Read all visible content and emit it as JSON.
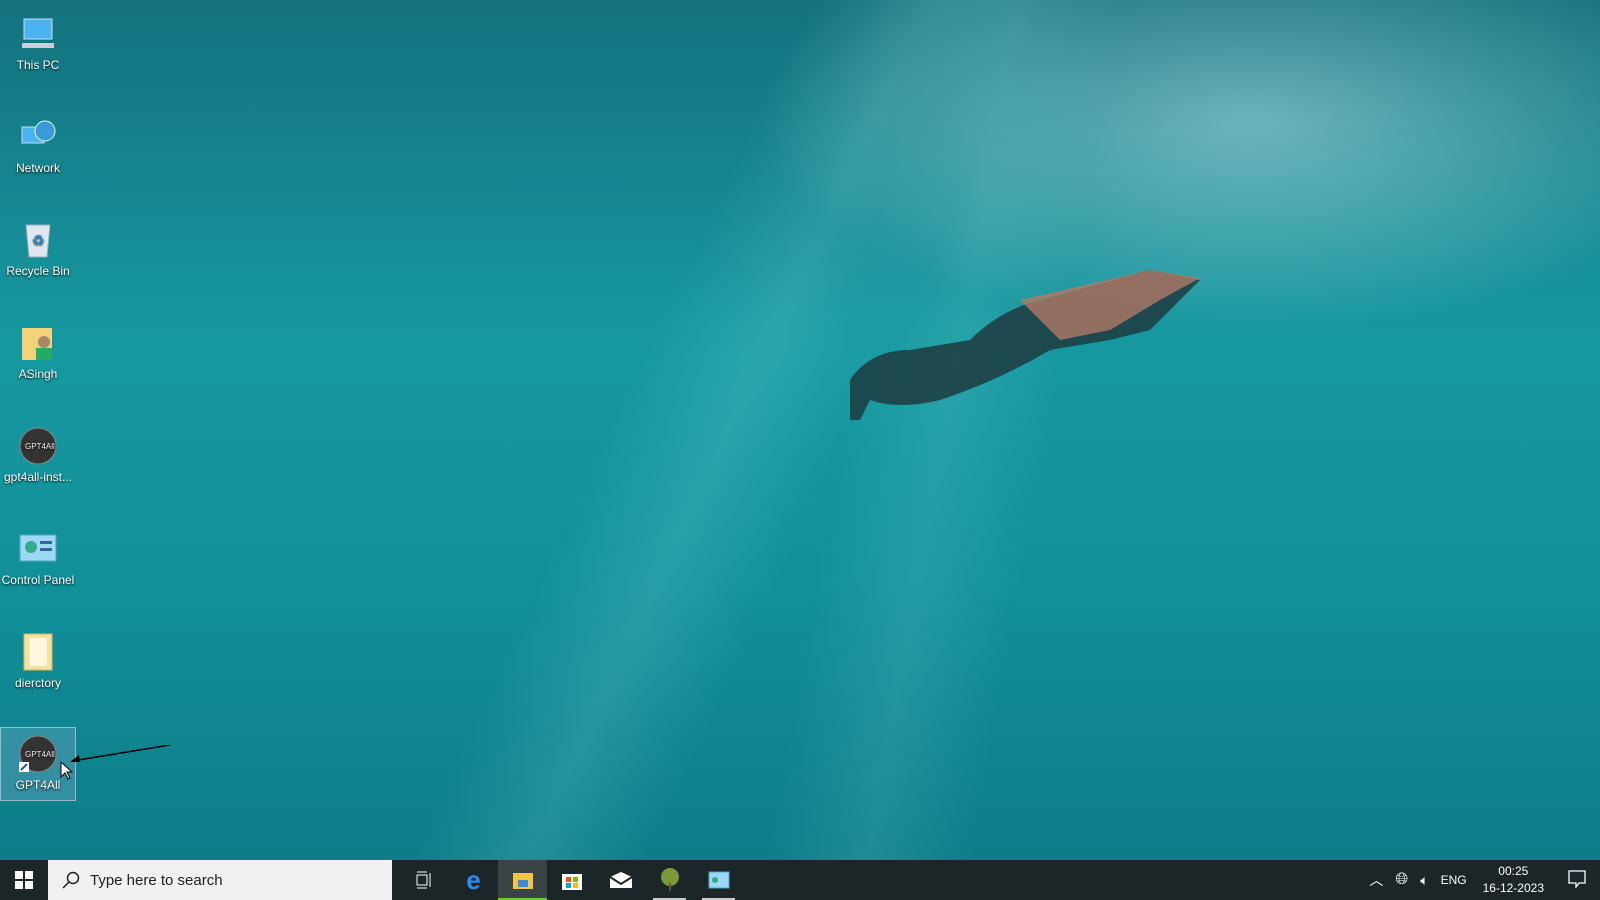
{
  "desktop": {
    "icons": [
      {
        "label": "This PC",
        "icon": "computer-icon"
      },
      {
        "label": "Network",
        "icon": "network-icon"
      },
      {
        "label": "Recycle Bin",
        "icon": "recycle-bin-icon"
      },
      {
        "label": "ASingh",
        "icon": "user-folder-icon"
      },
      {
        "label": "gpt4all-inst...",
        "icon": "gpt4all-installer-icon"
      },
      {
        "label": "Control Panel",
        "icon": "control-panel-icon"
      },
      {
        "label": "dierctory",
        "icon": "folder-icon"
      },
      {
        "label": "GPT4All",
        "icon": "gpt4all-shortcut-icon"
      }
    ]
  },
  "taskbar": {
    "search_placeholder": "Type here to search",
    "apps": [
      "task-view",
      "edge",
      "file-explorer",
      "store",
      "mail",
      "tree-app",
      "control-panel"
    ]
  },
  "tray": {
    "language": "ENG",
    "time": "00:25",
    "date": "16-12-2023"
  }
}
